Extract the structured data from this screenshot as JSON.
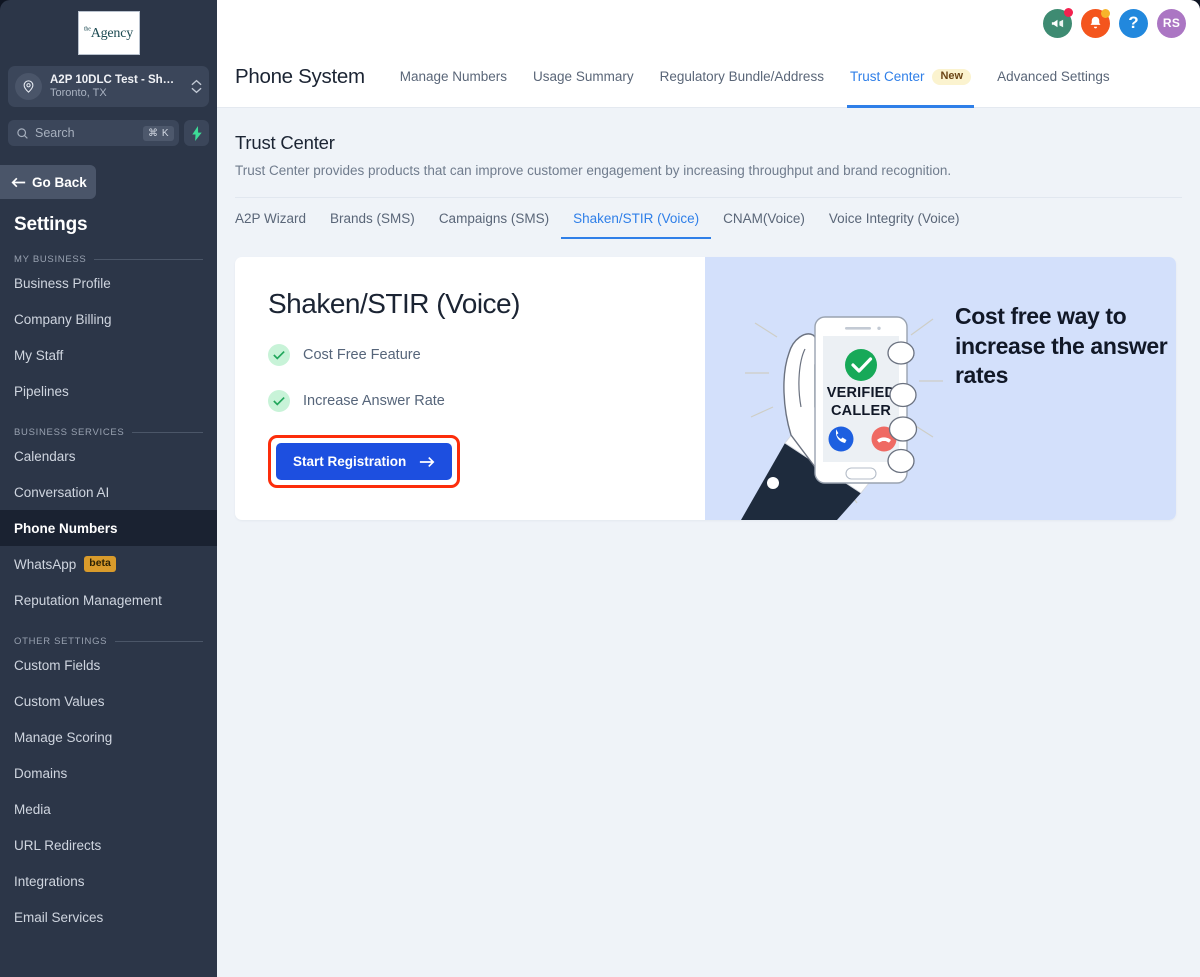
{
  "sidebar": {
    "logo": {
      "sup": "the",
      "main": "Agency",
      "icon": "agency-logo"
    },
    "location": {
      "name": "A2P 10DLC Test - Sh…",
      "sublabel": "Toronto, TX",
      "icon": "location-pin-icon",
      "chevron": "chevron-updown-icon"
    },
    "search": {
      "placeholder": "Search",
      "shortcut": "⌘ K",
      "icon": "search-icon",
      "bolt_icon": "lightning-bolt-icon"
    },
    "go_back": {
      "label": "Go Back",
      "icon": "arrow-left-icon"
    },
    "title": "Settings",
    "groups": [
      {
        "label": "MY BUSINESS",
        "items": [
          {
            "label": "Business Profile",
            "active": false
          },
          {
            "label": "Company Billing",
            "active": false
          },
          {
            "label": "My Staff",
            "active": false
          },
          {
            "label": "Pipelines",
            "active": false
          }
        ]
      },
      {
        "label": "BUSINESS SERVICES",
        "items": [
          {
            "label": "Calendars",
            "active": false
          },
          {
            "label": "Conversation AI",
            "active": false
          },
          {
            "label": "Phone Numbers",
            "active": true
          },
          {
            "label": "WhatsApp",
            "active": false,
            "badge": "beta"
          },
          {
            "label": "Reputation Management",
            "active": false
          }
        ]
      },
      {
        "label": "OTHER SETTINGS",
        "items": [
          {
            "label": "Custom Fields",
            "active": false
          },
          {
            "label": "Custom Values",
            "active": false
          },
          {
            "label": "Manage Scoring",
            "active": false
          },
          {
            "label": "Domains",
            "active": false
          },
          {
            "label": "Media",
            "active": false
          },
          {
            "label": "URL Redirects",
            "active": false
          },
          {
            "label": "Integrations",
            "active": false
          },
          {
            "label": "Email Services",
            "active": false
          }
        ]
      }
    ]
  },
  "topbar": {
    "icons": [
      {
        "name": "announcement-icon",
        "has_dot": true
      },
      {
        "name": "notification-bell-icon",
        "has_dot": true
      },
      {
        "name": "help-icon",
        "glyph": "?"
      },
      {
        "name": "user-avatar",
        "initials": "RS"
      }
    ]
  },
  "navbar": {
    "heading": "Phone System",
    "tabs": [
      {
        "label": "Manage Numbers",
        "active": false
      },
      {
        "label": "Usage Summary",
        "active": false
      },
      {
        "label": "Regulatory Bundle/Address",
        "active": false
      },
      {
        "label": "Trust Center",
        "active": true,
        "badge": "New"
      },
      {
        "label": "Advanced Settings",
        "active": false
      }
    ]
  },
  "page": {
    "title": "Trust Center",
    "subtitle": "Trust Center provides products that can improve customer engagement by increasing throughput and brand recognition.",
    "subtabs": [
      {
        "label": "A2P Wizard",
        "active": false
      },
      {
        "label": "Brands (SMS)",
        "active": false
      },
      {
        "label": "Campaigns (SMS)",
        "active": false
      },
      {
        "label": "Shaken/STIR (Voice)",
        "active": true
      },
      {
        "label": "CNAM(Voice)",
        "active": false
      },
      {
        "label": "Voice Integrity (Voice)",
        "active": false
      }
    ]
  },
  "hero": {
    "heading": "Shaken/STIR (Voice)",
    "features": [
      {
        "label": "Cost Free Feature",
        "icon": "check-circle-icon"
      },
      {
        "label": "Increase Answer Rate",
        "icon": "check-circle-icon"
      }
    ],
    "cta": {
      "label": "Start Registration",
      "icon": "arrow-right-icon",
      "highlighted": true
    },
    "promo_copy": "Cost free way to increase the answer rates",
    "illustration": {
      "name": "verified-caller-phone-illustration",
      "phone_badge": "check-circle-icon",
      "phone_line1": "VERIFIED",
      "phone_line2": "CALLER",
      "accept_icon": "phone-accept-icon",
      "decline_icon": "phone-decline-icon"
    }
  },
  "colors": {
    "sidebar_bg": "#2c3648",
    "sidebar_active": "#1a2231",
    "main_bg": "#eff3f8",
    "accent_blue": "#2f7fe8",
    "cta_blue": "#1d4fe0",
    "highlight_red": "#fc2d0b",
    "promo_panel": "#d3e0fb",
    "badge_beta": "#d99b2b",
    "badge_new": "#fbf3cf",
    "check_green": "#22a75c"
  }
}
